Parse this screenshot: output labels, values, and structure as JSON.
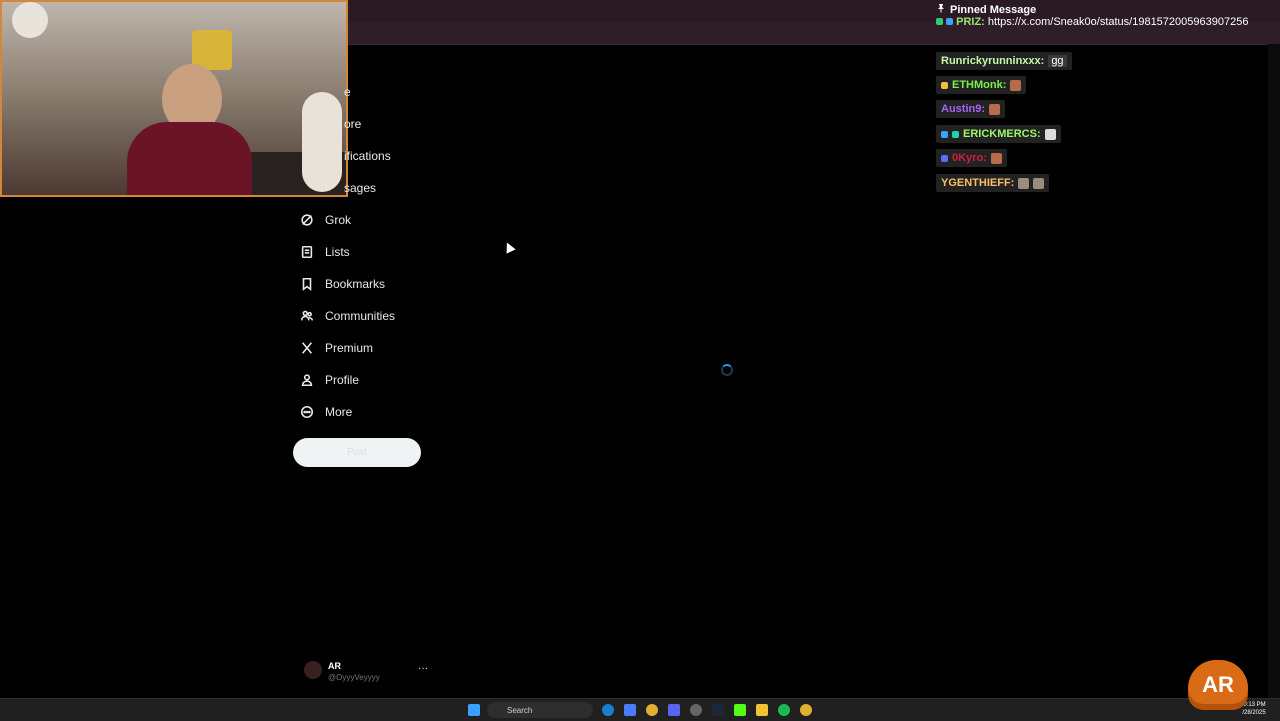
{
  "nav": {
    "partial_items": [
      {
        "label": "e",
        "icon": "home-icon"
      },
      {
        "label": "ore",
        "icon": "explore-icon"
      },
      {
        "label": "ifications",
        "icon": "notifications-icon"
      },
      {
        "label": "sages",
        "icon": "messages-icon"
      }
    ],
    "items": [
      {
        "label": "Grok",
        "icon": "grok-icon"
      },
      {
        "label": "Lists",
        "icon": "lists-icon"
      },
      {
        "label": "Bookmarks",
        "icon": "bookmark-icon"
      },
      {
        "label": "Communities",
        "icon": "communities-icon"
      },
      {
        "label": "Premium",
        "icon": "x-logo-icon"
      },
      {
        "label": "Profile",
        "icon": "person-icon"
      },
      {
        "label": "More",
        "icon": "more-circle-icon"
      }
    ],
    "post_button": "Post"
  },
  "account": {
    "name": "AR",
    "handle": "@OyyyVeyyyy",
    "menu": "···"
  },
  "pinned": {
    "title": "Pinned Message",
    "author": "PRIZ:",
    "text": "https://x.com/Sneak0o/status/1981572005963907256"
  },
  "chat": [
    {
      "user": "Runrickyrunninxxx:",
      "color": "#c8f7a4",
      "text": "gg"
    },
    {
      "user": "ETHMonk:",
      "color": "#7cf04a",
      "text": ""
    },
    {
      "user": "Austin9:",
      "color": "#a565f0",
      "text": ""
    },
    {
      "user": "ERICKMERCS:",
      "color": "#9ef76b",
      "text": ""
    },
    {
      "user": "0Kyro:",
      "color": "#d51d3f",
      "text": ""
    },
    {
      "user": "YGENTHIEFF:",
      "color": "#f4c26b",
      "text": ""
    }
  ],
  "taskbar": {
    "search_label": "Search",
    "time": "10:13 PM",
    "date": "/28/2025"
  },
  "overlay_logo": "AR",
  "colors": {
    "accent": "#1d9bf0",
    "background": "#000000",
    "stream_border": "#d4863a",
    "logo": "#d96a16"
  }
}
